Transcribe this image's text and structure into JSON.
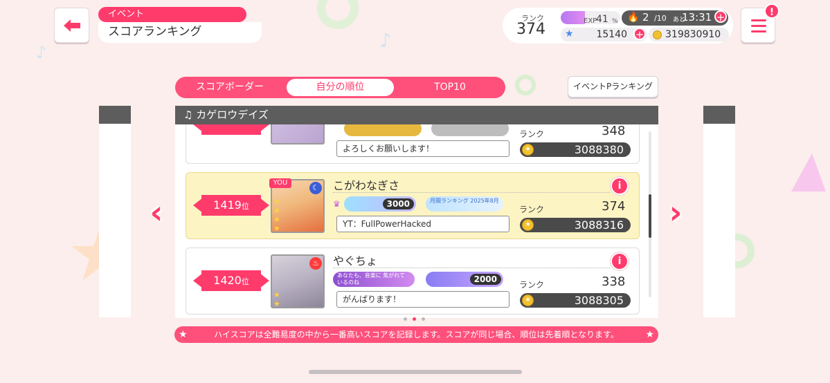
{
  "header": {
    "category": "イベント",
    "title": "スコアランキング"
  },
  "status": {
    "rank_label": "ランク",
    "rank": "374",
    "exp_label": "EXP",
    "exp_value": "41",
    "exp_unit": "%",
    "exp_progress": 0.41,
    "stamina_current": "2",
    "stamina_max": "/10",
    "stamina_time_label": "あと",
    "stamina_time": "13:31",
    "stars": "15140",
    "coins": "319830910",
    "plus": "+"
  },
  "menu_badge": "!",
  "tabs": [
    {
      "label": "スコアボーダー",
      "active": false
    },
    {
      "label": "自分の順位",
      "active": true
    },
    {
      "label": "TOP10",
      "active": false
    }
  ],
  "event_p_ranking_button": "イベントPランキング",
  "panel_title": "カゲロウデイズ",
  "panel_title_icon": "♫",
  "rank_suffix": "位",
  "you_label": "YOU",
  "info_label": "i",
  "rows": [
    {
      "rank": "",
      "name": "",
      "comment": "よろしくお願いします！",
      "level_label": "ランク",
      "level": "348",
      "score": "3088380"
    },
    {
      "rank": "1419",
      "name": "こがわなぎさ",
      "badge1_value": "3000",
      "badge2_text": "月間ランキング 2025年8月",
      "comment": "YT：FullPowerHacked",
      "level_label": "ランク",
      "level": "374",
      "score": "3088316"
    },
    {
      "rank": "1420",
      "name": "やぐちょ",
      "badge1_text": "あなたも、音楽に 焦がれているのね",
      "badge2_value": "2000",
      "comment": "がんばります！",
      "level_label": "ランク",
      "level": "338",
      "score": "3088305"
    }
  ],
  "notice": "ハイスコアは全難易度の中から一番高いスコアを記録します。スコアが同じ場合、順位は先着順となります。",
  "colors": {
    "accent": "#ff3b6c",
    "background": "#fbeeec",
    "highlight_row": "#fdf4c3",
    "dark": "#5d5d5d"
  }
}
